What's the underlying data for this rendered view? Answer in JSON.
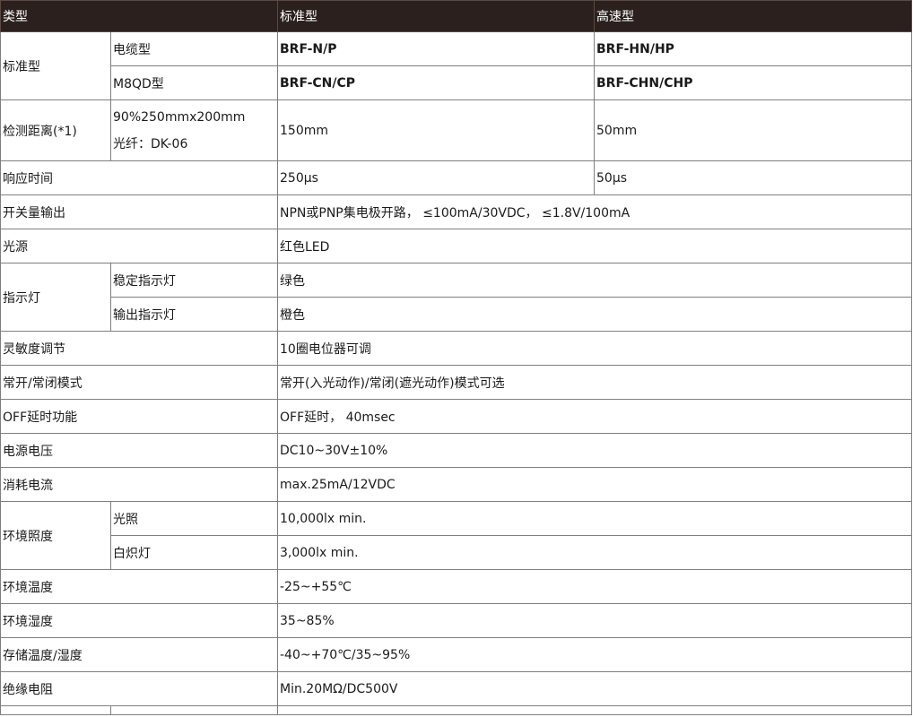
{
  "header": {
    "type": "类型",
    "standard": "标准型",
    "highspeed": "高速型"
  },
  "rows": {
    "standard_type": "标准型",
    "cable": {
      "label": "电缆型",
      "std": "BRF-N/P",
      "hs": "BRF-HN/HP"
    },
    "m8qd": {
      "label": "M8QD型",
      "std": "BRF-CN/CP",
      "hs": "BRF-CHN/CHP"
    },
    "distance": {
      "label": "检测距离(*1)",
      "cond1": "90%250mmx200mm",
      "cond2": "光纤：DK-06",
      "std": "150mm",
      "hs": "50mm"
    },
    "response": {
      "label": "响应时间",
      "std": "250μs",
      "hs": "50μs"
    },
    "output": {
      "label": "开关量输出",
      "value": "NPN或PNP集电极开路， ≤100mA/30VDC， ≤1.8V/100mA"
    },
    "light": {
      "label": "光源",
      "value": "红色LED"
    },
    "indicator": {
      "label": "指示灯",
      "stable_label": "稳定指示灯",
      "stable_value": "绿色",
      "output_label": "输出指示灯",
      "output_value": "橙色"
    },
    "sensitivity": {
      "label": "灵敏度调节",
      "value": "10圈电位器可调"
    },
    "mode": {
      "label": "常开/常闭模式",
      "value": "常开(入光动作)/常闭(遮光动作)模式可选"
    },
    "off_delay": {
      "label": "OFF延时功能",
      "value": "OFF延时， 40msec"
    },
    "voltage": {
      "label": "电源电压",
      "value": "DC10~30V±10%"
    },
    "current": {
      "label": "消耗电流",
      "value": "max.25mA/12VDC"
    },
    "illuminance": {
      "label": "环境照度",
      "sun_label": "光照",
      "sun_value": "10,000lx min.",
      "lamp_label": "白炽灯",
      "lamp_value": "3,000lx min."
    },
    "temperature": {
      "label": "环境温度",
      "value": "-25~+55℃"
    },
    "humidity": {
      "label": "环境湿度",
      "value": "35~85%"
    },
    "storage": {
      "label": "存储温度/湿度",
      "value": "-40~+70℃/35~95%"
    },
    "insulation": {
      "label": "绝缘电阻",
      "value": "Min.20MΩ/DC500V"
    }
  }
}
